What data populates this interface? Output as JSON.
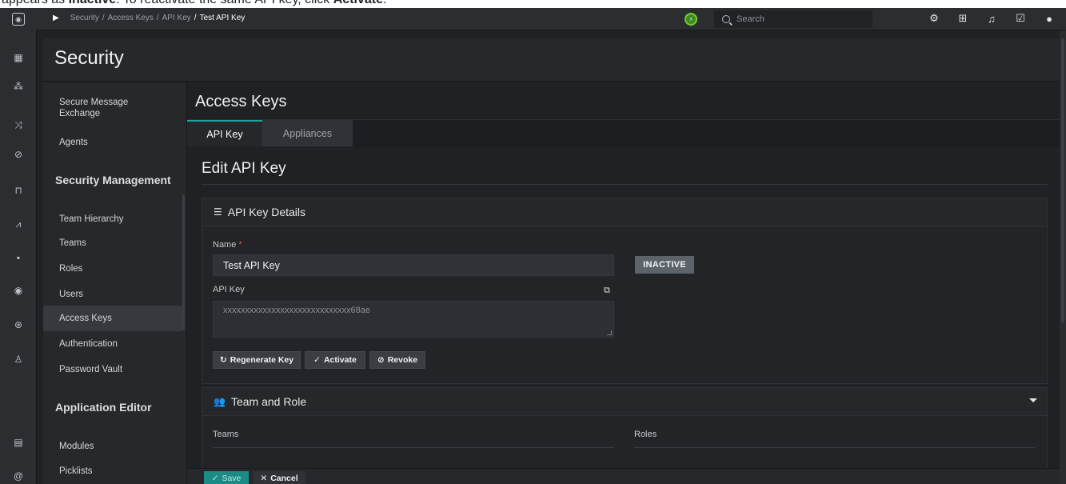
{
  "caption": {
    "text_before": "appears as ",
    "bold1": "Inactive",
    "text_mid": ". To reactivate the same API key, click ",
    "bold2": "Activate",
    "text_after": "."
  },
  "topbar": {
    "breadcrumb": [
      "Security",
      "Access Keys",
      "API Key"
    ],
    "breadcrumb_current": "Test API Key",
    "search_placeholder": "Search"
  },
  "page": {
    "title": "Security"
  },
  "sidebar": {
    "items_top": [
      {
        "label": "Secure Message\nExchange"
      },
      {
        "label": "Agents"
      }
    ],
    "heading_security": "Security Management",
    "items_security": [
      {
        "label": "Team Hierarchy"
      },
      {
        "label": "Teams"
      },
      {
        "label": "Roles"
      },
      {
        "label": "Users"
      },
      {
        "label": "Access Keys",
        "active": true
      },
      {
        "label": "Authentication"
      },
      {
        "label": "Password Vault"
      }
    ],
    "heading_app": "Application Editor",
    "items_app": [
      {
        "label": "Modules"
      },
      {
        "label": "Picklists"
      }
    ]
  },
  "main": {
    "section_title": "Access Keys",
    "tabs": [
      {
        "label": "API Key",
        "active": true
      },
      {
        "label": "Appliances"
      }
    ],
    "edit_title": "Edit API Key",
    "details": {
      "heading": "API Key Details",
      "name_label": "Name",
      "name_required": "*",
      "name_value": "Test API Key",
      "status_badge": "INACTIVE",
      "key_label": "API Key",
      "key_value": "xxxxxxxxxxxxxxxxxxxxxxxxxxxxx68ae",
      "buttons": {
        "regenerate": "Regenerate Key",
        "activate": "Activate",
        "revoke": "Revoke"
      }
    },
    "team_role": {
      "heading": "Team and Role",
      "teams_label": "Teams",
      "roles_label": "Roles"
    }
  },
  "footer": {
    "save": "Save",
    "cancel": "Cancel"
  },
  "colors": {
    "accent": "#1fa39b",
    "status_ok": "#6fcf2f",
    "badge_inactive": "#5d636b"
  }
}
